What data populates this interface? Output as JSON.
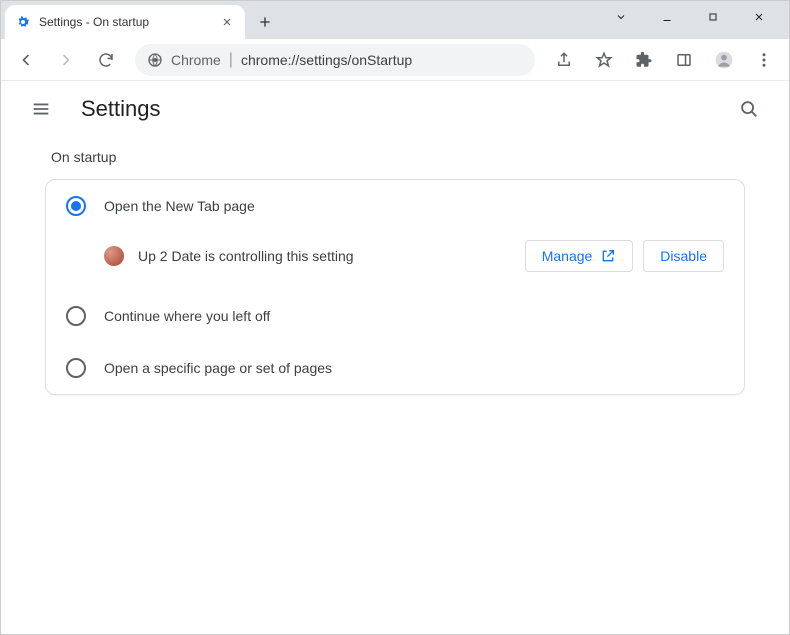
{
  "window": {
    "tab_title": "Settings - On startup"
  },
  "toolbar": {
    "omnibox_chip": "Chrome",
    "omnibox_url": "chrome://settings/onStartup"
  },
  "header": {
    "title": "Settings"
  },
  "section": {
    "title": "On startup"
  },
  "options": {
    "o1": {
      "label": "Open the New Tab page",
      "selected": true
    },
    "o2": {
      "label": "Continue where you left off",
      "selected": false
    },
    "o3": {
      "label": "Open a specific page or set of pages",
      "selected": false
    }
  },
  "extension_notice": {
    "text": "Up 2 Date is controlling this setting",
    "manage_label": "Manage",
    "disable_label": "Disable"
  }
}
